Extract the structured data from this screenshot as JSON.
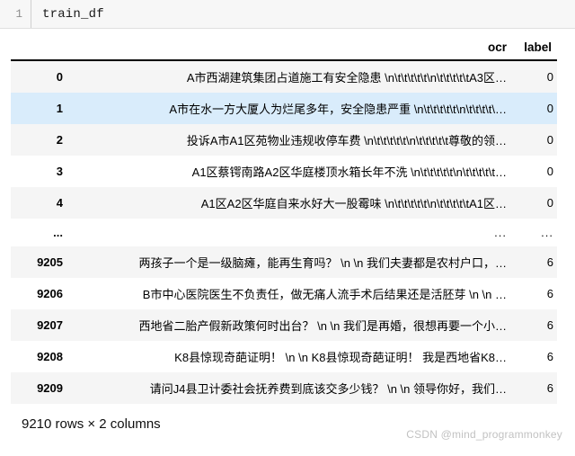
{
  "notebook": {
    "cell": {
      "prompt": "1",
      "code": "train_df"
    }
  },
  "dataframe": {
    "columns": [
      "ocr",
      "label"
    ],
    "index_header": "",
    "rows": [
      {
        "index": "0",
        "ocr": "A市西湖建筑集团占道施工有安全隐患 \\n\\t\\t\\t\\t\\t\\n\\t\\t\\t\\t\\tA3区…",
        "label": "0"
      },
      {
        "index": "1",
        "ocr": "A市在水一方大厦人为烂尾多年，安全隐患严重 \\n\\t\\t\\t\\t\\t\\n\\t\\t\\t\\t\\…",
        "label": "0"
      },
      {
        "index": "2",
        "ocr": "投诉A市A1区苑物业违规收停车费 \\n\\t\\t\\t\\t\\t\\n\\t\\t\\t\\t\\t尊敬的领…",
        "label": "0"
      },
      {
        "index": "3",
        "ocr": "A1区蔡锷南路A2区华庭楼顶水箱长年不洗 \\n\\t\\t\\t\\t\\t\\n\\t\\t\\t\\t\\t…",
        "label": "0"
      },
      {
        "index": "4",
        "ocr": "A1区A2区华庭自来水好大一股霉味 \\n\\t\\t\\t\\t\\t\\n\\t\\t\\t\\t\\tA1区…",
        "label": "0"
      },
      {
        "index": "...",
        "ocr": "...",
        "label": "..."
      },
      {
        "index": "9205",
        "ocr": "两孩子一个是一级脑瘫，能再生育吗？ \\n \\n     我们夫妻都是农村户口，…",
        "label": "6"
      },
      {
        "index": "9206",
        "ocr": "B市中心医院医生不负责任，做无痛人流手术后结果还是活胚芽 \\n \\n      …",
        "label": "6"
      },
      {
        "index": "9207",
        "ocr": "西地省二胎产假新政策何时出台？ \\n \\n     我们是再婚，很想再要一个小…",
        "label": "6"
      },
      {
        "index": "9208",
        "ocr": "K8县惊现奇葩证明！ \\n \\n K8县惊现奇葩证明！      我是西地省K8…",
        "label": "6"
      },
      {
        "index": "9209",
        "ocr": "请问J4县卫计委社会抚养费到底该交多少钱？ \\n \\n      领导你好，我们…",
        "label": "6"
      }
    ],
    "footer": "9210 rows × 2 columns"
  },
  "watermark": {
    "text": "CSDN @mind_programmonkey"
  },
  "colors": {
    "row_stripe": "#f5f5f5",
    "row_hover": "#d9ecfb",
    "cell_background": "#f7f7f7",
    "watermark": "#c2c2c2"
  }
}
